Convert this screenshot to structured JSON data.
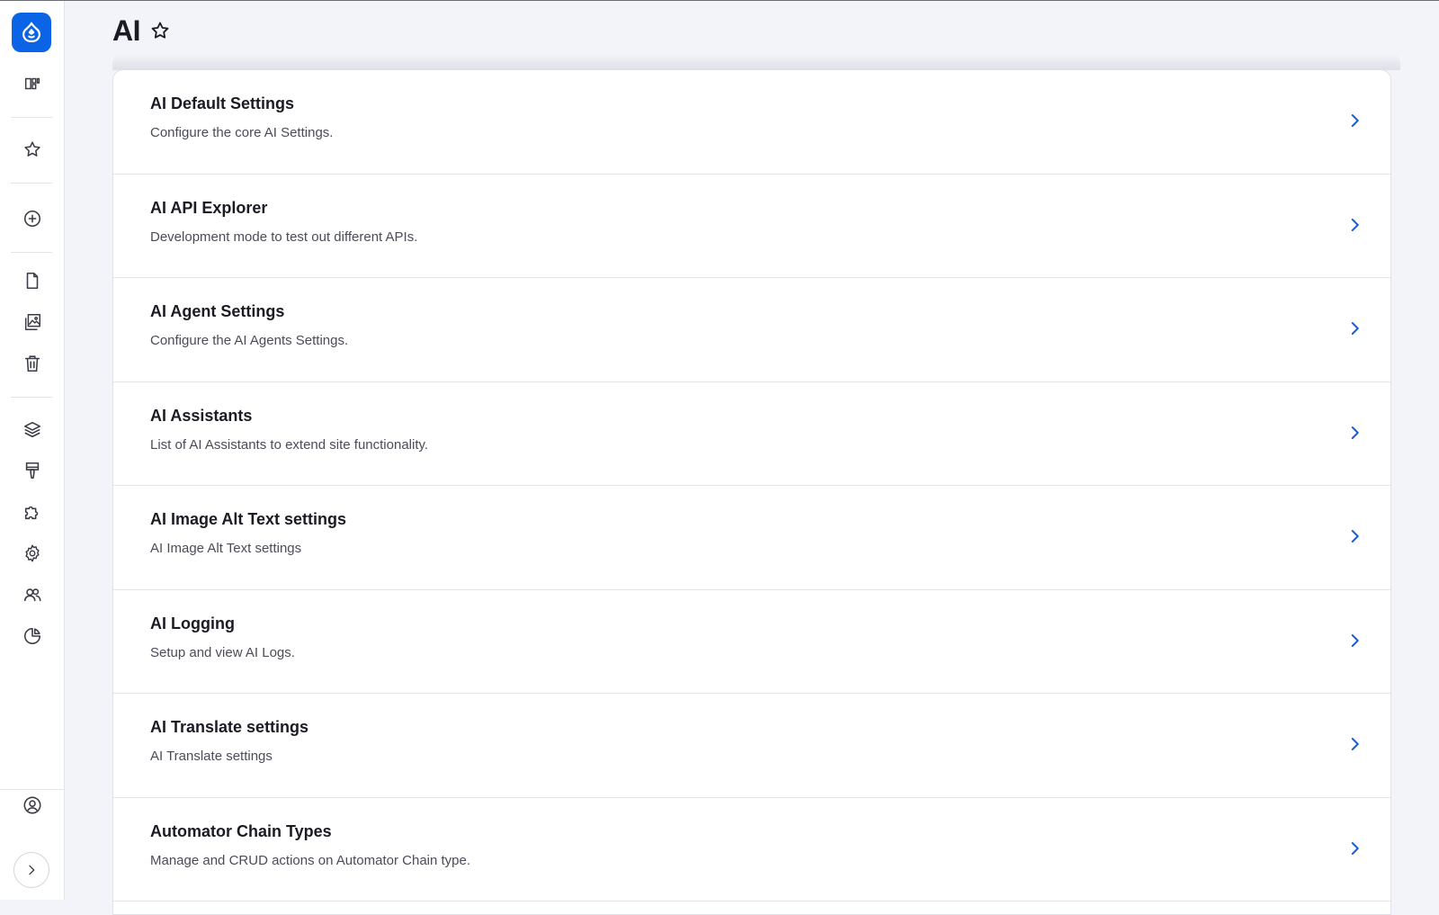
{
  "colors": {
    "brand": "#0b63e5",
    "link_arrow": "#1a5bd6",
    "text": "#1b1b24",
    "muted_text": "#4b4c57",
    "background": "#f3f4f9"
  },
  "sidebar": {
    "logo_icon": "drupal-drop-icon",
    "items": [
      {
        "name": "dashboard-icon"
      },
      {
        "name": "star-icon"
      },
      {
        "name": "add-circle-icon"
      },
      {
        "name": "file-icon"
      },
      {
        "name": "media-gallery-icon"
      },
      {
        "name": "trash-icon"
      },
      {
        "name": "layers-icon"
      },
      {
        "name": "brush-icon"
      },
      {
        "name": "puzzle-icon"
      },
      {
        "name": "gear-icon"
      },
      {
        "name": "users-icon"
      },
      {
        "name": "pie-chart-icon"
      }
    ],
    "footer": [
      {
        "name": "user-circle-icon"
      },
      {
        "name": "chevron-right-icon"
      }
    ]
  },
  "header": {
    "title": "AI",
    "favorite_icon": "star-outline-icon"
  },
  "items": [
    {
      "title": "AI Default Settings",
      "description": "Configure the core AI Settings."
    },
    {
      "title": "AI API Explorer",
      "description": "Development mode to test out different APIs."
    },
    {
      "title": "AI Agent Settings",
      "description": "Configure the AI Agents Settings."
    },
    {
      "title": "AI Assistants",
      "description": "List of AI Assistants to extend site functionality."
    },
    {
      "title": "AI Image Alt Text settings",
      "description": "AI Image Alt Text settings"
    },
    {
      "title": "AI Logging",
      "description": "Setup and view AI Logs."
    },
    {
      "title": "AI Translate settings",
      "description": "AI Translate settings"
    },
    {
      "title": "Automator Chain Types",
      "description": "Manage and CRUD actions on Automator Chain type."
    }
  ]
}
